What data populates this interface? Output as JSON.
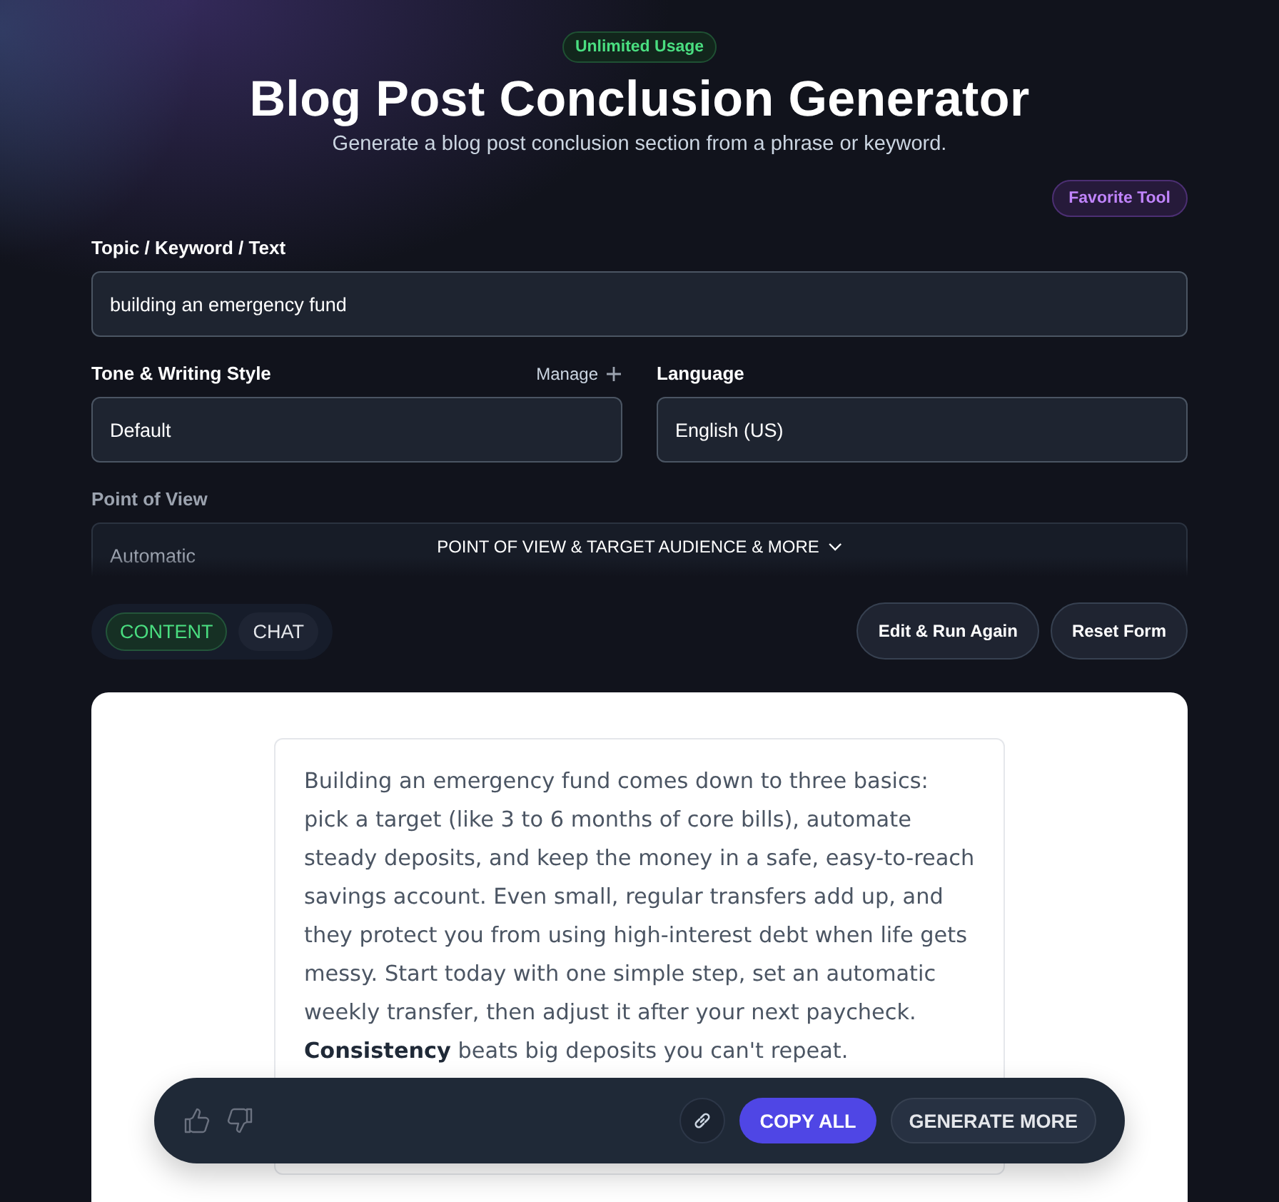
{
  "header": {
    "badge": "Unlimited Usage",
    "title": "Blog Post Conclusion Generator",
    "subtitle": "Generate a blog post conclusion section from a phrase or keyword.",
    "favorite": "Favorite Tool"
  },
  "form": {
    "topic": {
      "label": "Topic / Keyword / Text",
      "value": "building an emergency fund"
    },
    "tone": {
      "label": "Tone & Writing Style",
      "manage": "Manage",
      "value": "Default"
    },
    "language": {
      "label": "Language",
      "value": "English (US)"
    },
    "more": {
      "label": "Point of View",
      "value": "Automatic",
      "toggle": "POINT OF VIEW & TARGET AUDIENCE & MORE",
      "expanded": false
    }
  },
  "tabs": [
    {
      "label": "CONTENT",
      "selected": true
    },
    {
      "label": "CHAT",
      "selected": false
    }
  ],
  "actions": [
    "Edit & Run Again",
    "Reset Form"
  ],
  "output": {
    "text": "Building an emergency fund comes down to three basics: pick a target (like 3 to 6 months of core bills), automate steady deposits, and keep the money in a safe, easy-to-reach savings account. Even small, regular transfers add up, and they protect you from using high-interest debt when life gets messy. Start today with one simple step, set an automatic weekly transfer, then adjust it after your next paycheck. **Consistency** beats big deposits you can't repeat."
  },
  "toolbar": {
    "copy": "COPY ALL",
    "generate": "GENERATE MORE"
  }
}
